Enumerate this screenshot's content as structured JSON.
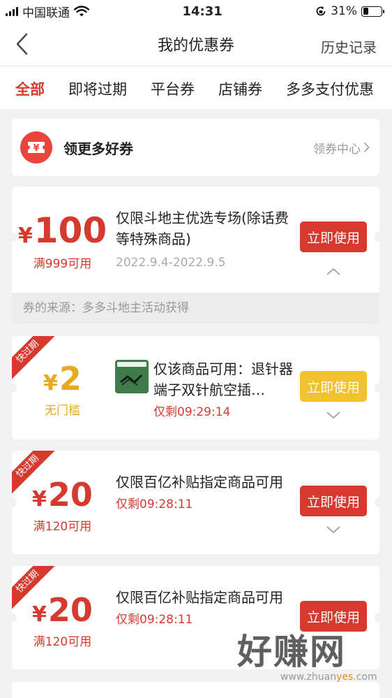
{
  "status_bar": {
    "carrier": "中国联通",
    "time": "14:31",
    "battery": "31%",
    "battery_level": 0.31
  },
  "nav": {
    "title": "我的优惠券",
    "history": "历史记录"
  },
  "tabs": [
    {
      "label": "全部",
      "active": true
    },
    {
      "label": "即将过期"
    },
    {
      "label": "平台券"
    },
    {
      "label": "店铺券"
    },
    {
      "label": "多多支付优惠"
    }
  ],
  "promo": {
    "icon_symbol": "¥",
    "title": "领更多好券",
    "link": "领券中心"
  },
  "coupons": [
    {
      "currency": "¥",
      "amount": "100",
      "condition": "满999可用",
      "desc": "仅限斗地主优选专场(除话费等特殊商品)",
      "date": "2022.9.4-2022.9.5",
      "button": "立即使用",
      "source": "券的来源：多多斗地主活动获得"
    },
    {
      "ribbon": "快过期",
      "currency": "¥",
      "amount": "2",
      "condition": "无门槛",
      "desc": "仅该商品可用：退针器端子双针航空插…",
      "countdown": "仅剩09:29:14",
      "button": "立即使用",
      "color": "#f2c132"
    },
    {
      "ribbon": "快过期",
      "currency": "¥",
      "amount": "20",
      "condition": "满120可用",
      "desc": "仅限百亿补贴指定商品可用",
      "countdown": "仅剩09:28:11",
      "button": "立即使用"
    },
    {
      "ribbon": "快过期",
      "currency": "¥",
      "amount": "20",
      "condition": "满120可用",
      "desc": "仅限百亿补贴指定商品可用",
      "countdown": "仅剩09:28:11",
      "button": "立即使用"
    }
  ],
  "watermark": {
    "title": "好赚网",
    "url_pre": "www.zhuan",
    "url_mid": "yes",
    "url_post": ".com"
  },
  "colors": {
    "accent": "#d63a2f",
    "yellow": "#f2c132",
    "background": "#f2f2f2"
  }
}
